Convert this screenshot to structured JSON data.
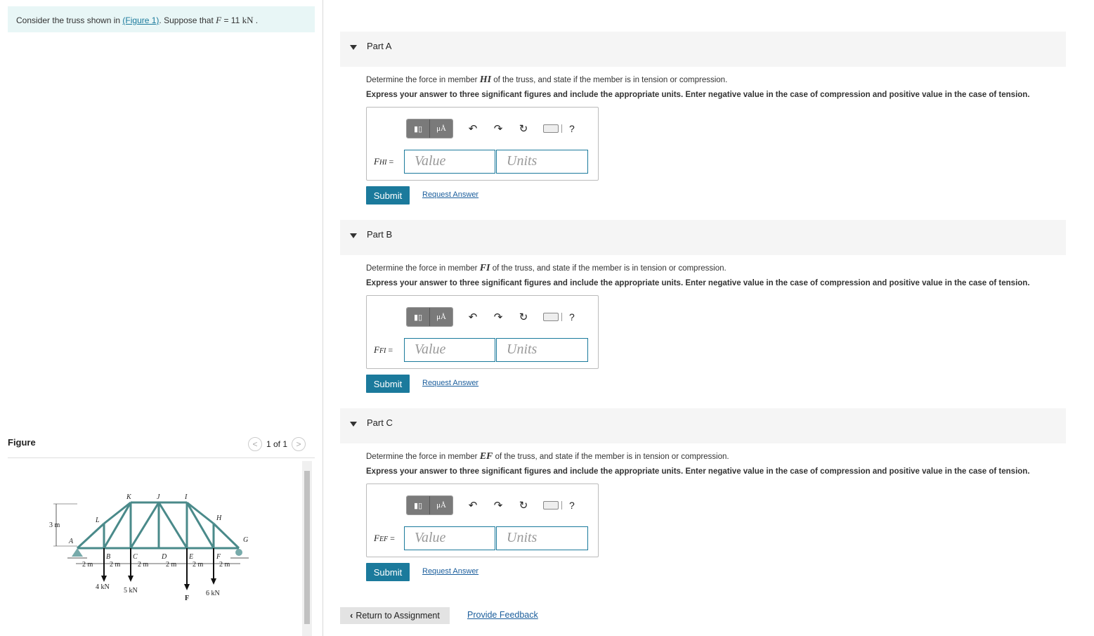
{
  "intro": {
    "prefix": "Consider the truss shown in ",
    "link": "(Figure 1)",
    "mid": ". Suppose that ",
    "var": "F",
    "eq": " = 11 ",
    "unit": "kN",
    "end": " ."
  },
  "figure": {
    "heading": "Figure",
    "pager": "1 of 1",
    "prev_icon": "chevron-left-icon",
    "next_icon": "chevron-right-icon",
    "labels": {
      "K": "K",
      "J": "J",
      "I": "I",
      "H": "H",
      "L": "L",
      "G": "G",
      "A": "A",
      "B": "B",
      "C": "C",
      "D": "D",
      "E": "E",
      "F": "F",
      "height": "3 m",
      "span": "2 m",
      "load1": "4 kN",
      "load2": "5 kN",
      "load3": "F",
      "load4": "6 kN"
    }
  },
  "parts": [
    {
      "label": "Part A",
      "question_pre": "Determine the force in member ",
      "member": "HI",
      "question_post": " of the truss, and state if the member is in tension or compression.",
      "express": "Express your answer to three significant figures and include the appropriate units. Enter negative value in the case of compression and positive value in the case of tension.",
      "field_var": "F",
      "field_sub": "HI",
      "field_eq": " =",
      "value_placeholder": "Value",
      "units_placeholder": "Units",
      "submit": "Submit",
      "request": "Request Answer"
    },
    {
      "label": "Part B",
      "question_pre": "Determine the force in member ",
      "member": "FI",
      "question_post": " of the truss, and state if the member is in tension or compression.",
      "express": "Express your answer to three significant figures and include the appropriate units. Enter negative value in the case of compression and positive value in the case of tension.",
      "field_var": "F",
      "field_sub": "FI",
      "field_eq": " =",
      "value_placeholder": "Value",
      "units_placeholder": "Units",
      "submit": "Submit",
      "request": "Request Answer"
    },
    {
      "label": "Part C",
      "question_pre": "Determine the force in member ",
      "member": "EF",
      "question_post": " of the truss, and state if the member is in tension or compression.",
      "express": "Express your answer to three significant figures and include the appropriate units. Enter negative value in the case of compression and positive value in the case of tension.",
      "field_var": "F",
      "field_sub": "EF",
      "field_eq": " =",
      "value_placeholder": "Value",
      "units_placeholder": "Units",
      "submit": "Submit",
      "request": "Request Answer"
    }
  ],
  "toolbar": {
    "units_btn": "μÅ",
    "help": "?"
  },
  "footer": {
    "return": "Return to Assignment",
    "feedback": "Provide Feedback"
  }
}
